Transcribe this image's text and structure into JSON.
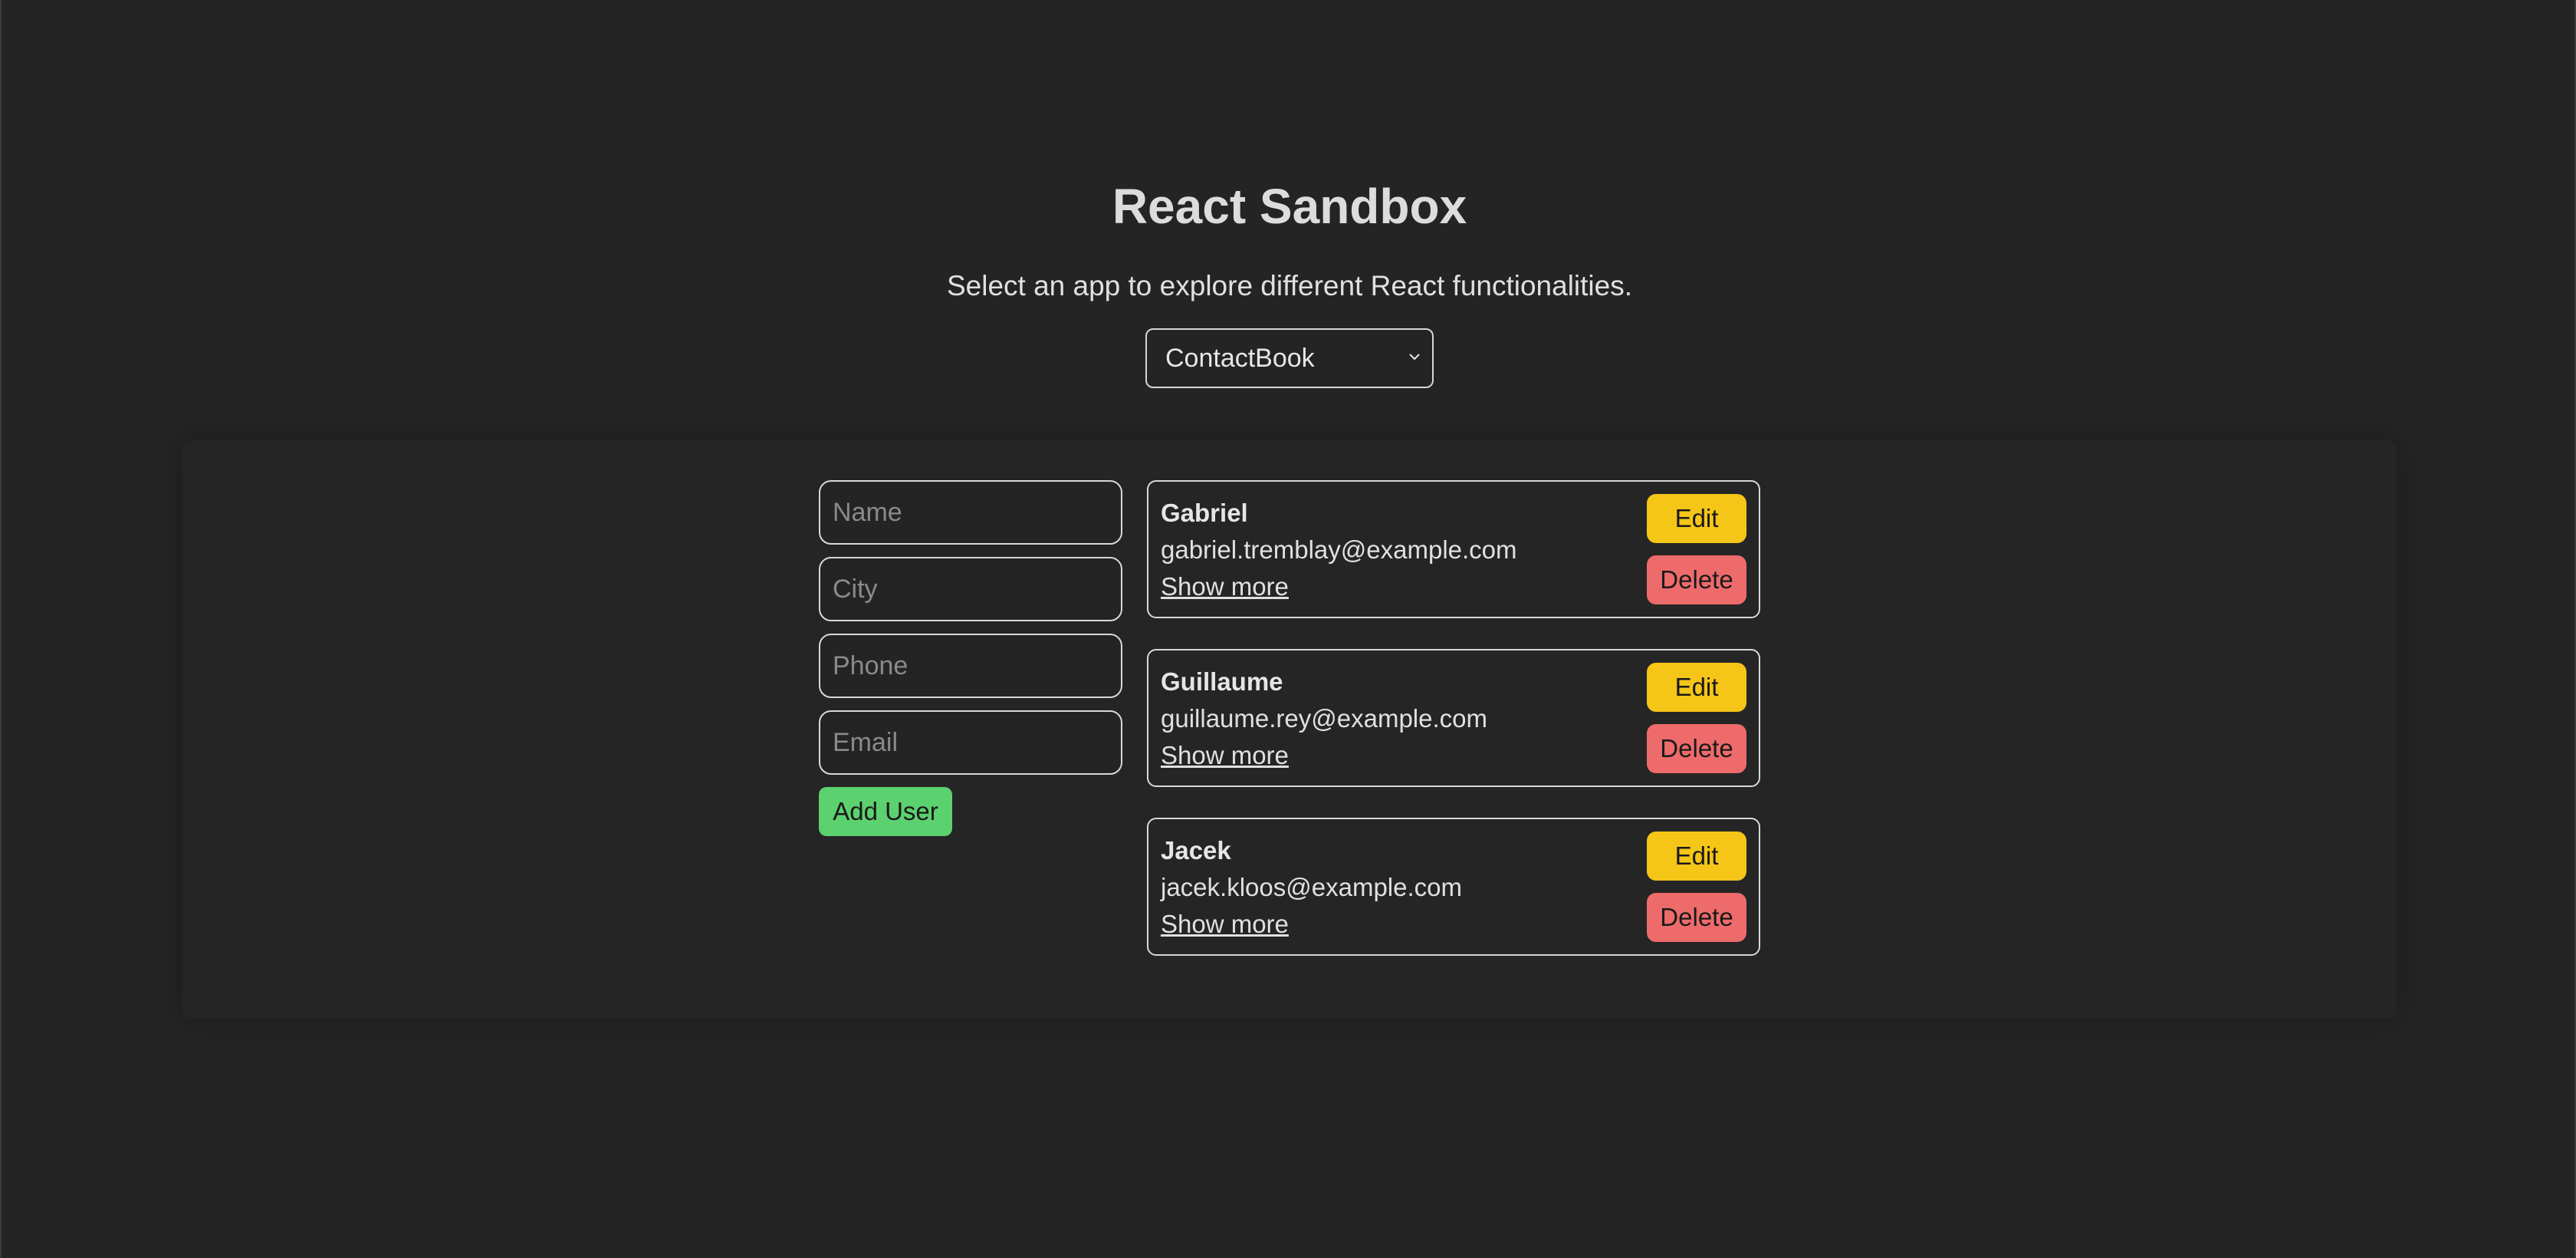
{
  "header": {
    "title": "React Sandbox",
    "subtitle": "Select an app to explore different React functionalities."
  },
  "app_select": {
    "selected": "ContactBook",
    "icon": "chevron-down-icon"
  },
  "form": {
    "name_placeholder": "Name",
    "city_placeholder": "City",
    "phone_placeholder": "Phone",
    "email_placeholder": "Email",
    "add_label": "Add User"
  },
  "contacts": [
    {
      "name": "Gabriel",
      "email": "gabriel.tremblay@example.com",
      "more": "Show more",
      "edit": "Edit",
      "delete": "Delete"
    },
    {
      "name": "Guillaume",
      "email": "guillaume.rey@example.com",
      "more": "Show more",
      "edit": "Edit",
      "delete": "Delete"
    },
    {
      "name": "Jacek",
      "email": "jacek.kloos@example.com",
      "more": "Show more",
      "edit": "Edit",
      "delete": "Delete"
    }
  ],
  "colors": {
    "background": "#242424",
    "add_button": "#5bd16f",
    "edit_button": "#f5c518",
    "delete_button": "#ee6b6b"
  }
}
